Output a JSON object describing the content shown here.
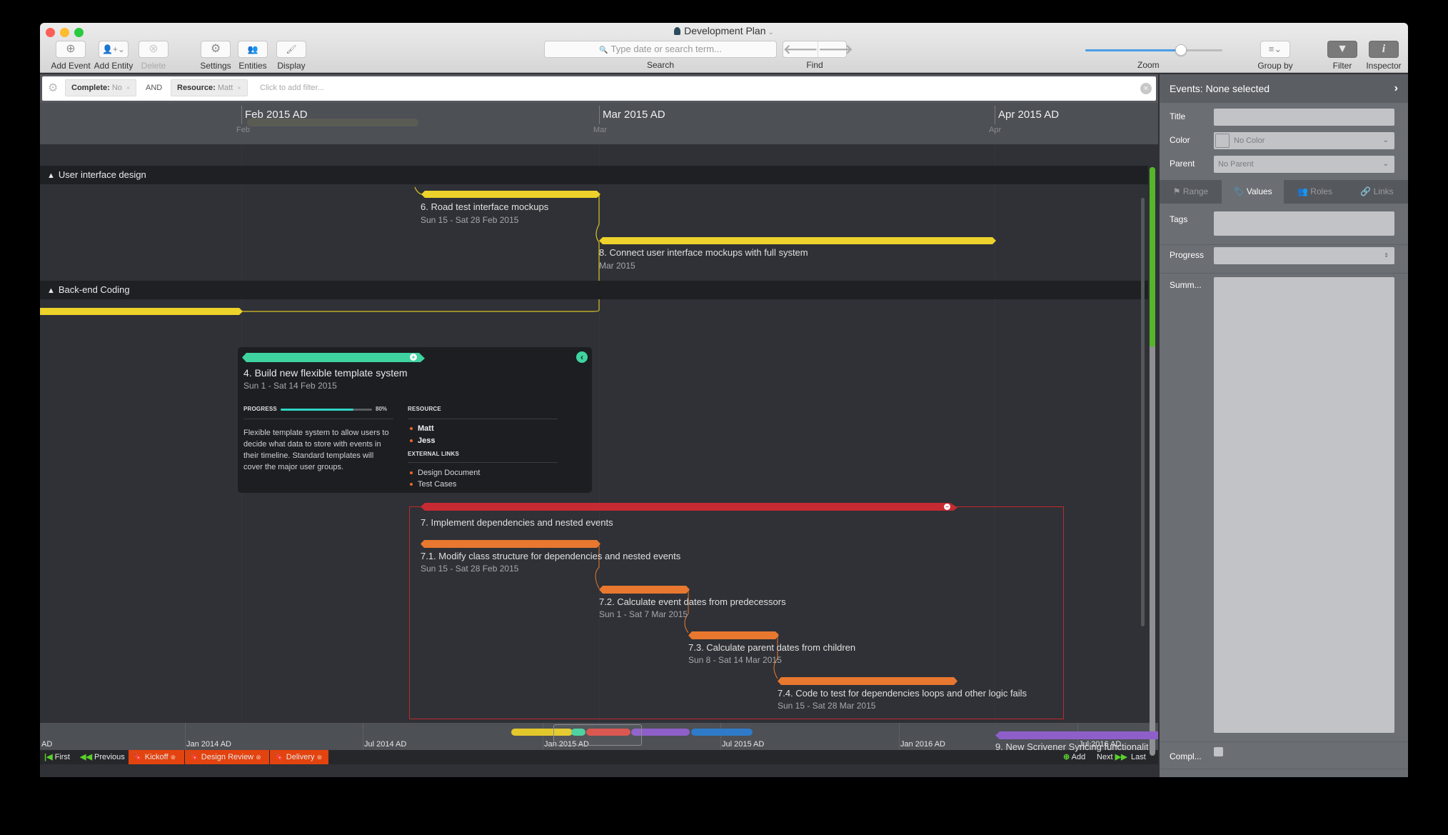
{
  "window": {
    "title": "Development Plan",
    "title_chevron": "⌄",
    "traffic_lights": {
      "close": "#fc5f57",
      "minimize": "#fdbb2e",
      "zoom": "#29c940"
    }
  },
  "toolbar": {
    "add_event": {
      "label": "Add Event",
      "icon": "⊕"
    },
    "add_entity": {
      "label": "Add Entity",
      "icon": "👤+⌄"
    },
    "delete": {
      "label": "Delete",
      "icon": "⊗"
    },
    "settings": {
      "label": "Settings",
      "icon": "⚙"
    },
    "entities": {
      "label": "Entities",
      "icon": "👥"
    },
    "display": {
      "label": "Display",
      "icon": "🖌"
    },
    "search": {
      "placeholder": "Type date or search term...",
      "icon": "🔍",
      "label": "Search"
    },
    "find": {
      "prev_icon": "🡐",
      "next_icon": "🡒",
      "label": "Find"
    },
    "zoom": {
      "label": "Zoom",
      "value_fraction": 0.7
    },
    "group_by": {
      "label": "Group by",
      "icon": "≡⌄"
    },
    "filter": {
      "label": "Filter",
      "icon": "▼"
    },
    "inspector": {
      "label": "Inspector",
      "icon": "i"
    }
  },
  "filter_bar": {
    "gear_icon": "⚙",
    "chips": [
      {
        "key": "Complete:",
        "value": "No",
        "remove": "×"
      },
      {
        "key": "Resource:",
        "value": "Matt",
        "remove": "×"
      }
    ],
    "conjunction": "AND",
    "add_placeholder": "Click to add filter...",
    "clear_icon": "×"
  },
  "timeline": {
    "months": [
      {
        "label": "Feb 2015 AD",
        "day_label": "Feb"
      },
      {
        "label": "Mar 2015 AD",
        "day_label": "Mar"
      },
      {
        "label": "Apr 2015 AD",
        "day_label": "Apr"
      }
    ],
    "groups": [
      {
        "label": "User interface design",
        "caret": "^"
      },
      {
        "label": "Back-end Coding",
        "caret": "^"
      }
    ],
    "events": {
      "e6": {
        "title": "6. Road test interface mockups",
        "date": "Sun 15 - Sat 28 Feb 2015",
        "color": "#ecd22a"
      },
      "e8": {
        "title": "8. Connect user interface mockups with full system",
        "date": "Mar 2015",
        "color": "#ecd22a"
      },
      "e7": {
        "title": "7. Implement dependencies and nested events",
        "color": "#c62a33"
      },
      "e71": {
        "title": "7.1. Modify class structure for dependencies and nested events",
        "date": "Sun 15 - Sat 28 Feb 2015",
        "color": "#e8782f"
      },
      "e72": {
        "title": "7.2. Calculate event dates from predecessors",
        "date": "Sun 1 - Sat 7 Mar 2015",
        "color": "#e8782f"
      },
      "e73": {
        "title": "7.3. Calculate parent dates from children",
        "date": "Sun 8 - Sat 14 Mar 2015",
        "color": "#e8782f"
      },
      "e74": {
        "title": "7.4. Code to test for dependencies loops and other logic fails",
        "date": "Sun 15 - Sat 28 Mar 2015",
        "color": "#e8782f"
      },
      "e9": {
        "title": "9. New Scrivener Syncing functionalit",
        "color": "#8e5fc8"
      }
    },
    "card": {
      "title": "4. Build new flexible template system",
      "date": "Sun 1 - Sat 14 Feb 2015",
      "progress_label": "PROGRESS",
      "progress_percent": 80,
      "progress_text": "80%",
      "description": "Flexible template system to allow users to decide what data to store with events in their timeline. Standard templates will cover the major user groups.",
      "resource_label": "RESOURCE",
      "resources": [
        "Matt",
        "Jess"
      ],
      "links_label": "EXTERNAL LINKS",
      "links": [
        "Design Document",
        "Test Cases"
      ],
      "color": "#3fd3a0",
      "back_icon": "‹",
      "expand_icon": "+"
    }
  },
  "overview": {
    "labels": [
      "AD",
      "Jan 2014 AD",
      "Jul 2014 AD",
      "Jan 2015 AD",
      "Jul 2015 AD",
      "Jan 2016 AD",
      "Jul 2016 AD"
    ]
  },
  "bottom_bar": {
    "first": {
      "icon": "|◀",
      "label": "First"
    },
    "previous": {
      "icon": "◀◀",
      "label": "Previous"
    },
    "bookmarks": [
      {
        "label": "Kickoff",
        "icon": "🔖",
        "close": "⊗"
      },
      {
        "label": "Design Review",
        "icon": "🔖",
        "close": "⊗"
      },
      {
        "label": "Delivery",
        "icon": "🔖",
        "close": "⊗"
      }
    ],
    "add": {
      "icon": "⊕",
      "label": "Add"
    },
    "next": {
      "icon": "▶▶",
      "label": "Next"
    },
    "last": {
      "icon": "▶|",
      "label": "Last"
    }
  },
  "inspector": {
    "header": "Events: None selected",
    "collapse_icon": "›",
    "fields": {
      "title_label": "Title",
      "title_value": "",
      "color_label": "Color",
      "color_value": "No Color",
      "parent_label": "Parent",
      "parent_value": "No Parent",
      "dropdown_icon": "⌄"
    },
    "tabs": [
      {
        "label": "Range",
        "icon": "⚑"
      },
      {
        "label": "Values",
        "icon": "🏷",
        "active": true
      },
      {
        "label": "Roles",
        "icon": "👥"
      },
      {
        "label": "Links",
        "icon": "🔗"
      }
    ],
    "values": {
      "tags_label": "Tags",
      "progress_label": "Progress",
      "summary_label": "Summ...",
      "complete_label": "Compl...",
      "complete_checked": false
    }
  }
}
